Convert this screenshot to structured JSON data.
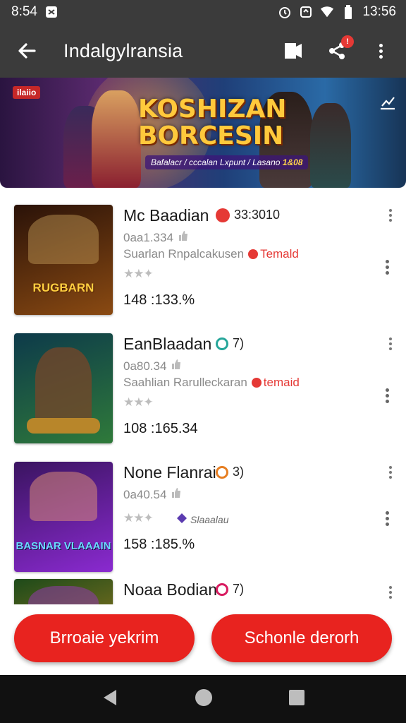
{
  "status_bar": {
    "time": "8:54",
    "clock_right": "13:56"
  },
  "app_bar": {
    "title": "Indalgylransia",
    "notification_count": "!"
  },
  "banner": {
    "tag": "ilaiio",
    "headline_line1": "KOSHIZAN",
    "headline_line2": "BORCESIN",
    "sub_text": "Bafalacr / cccalan Lxpunt / Lasano",
    "sub_highlight": "1&08"
  },
  "items": [
    {
      "name": "Mc Baadian",
      "pill_text": "33:3010",
      "pill_color": "#e53935",
      "meta": "0aa1.334",
      "desc": "Suarlan Rnpalcakusen",
      "desc_tag": "Temald",
      "score": "148 :133.%",
      "thumb_title": "RUGBARN",
      "thumb_colors": [
        "#2a1208",
        "#8a4a12"
      ]
    },
    {
      "name": "EanBlaadan",
      "pill_text": "7)",
      "pill_color": "#26a69a",
      "meta": "0a80.34",
      "desc": "Saahlian Rarulleckaran",
      "desc_tag": "temaid",
      "score": "108 :165.34",
      "thumb_title": "",
      "thumb_colors": [
        "#0d3a4a",
        "#2f7a3a"
      ]
    },
    {
      "name": "None Flanrai",
      "pill_text": "3)",
      "pill_color": "#e67e22",
      "meta": "0a40.54",
      "desc": "",
      "desc_tag": "",
      "badge_label": "Slaaalau",
      "score": "158 :185.%",
      "thumb_title": "BASNAR VLAAAIN",
      "thumb_colors": [
        "#3a1460",
        "#8a2ad0"
      ]
    },
    {
      "name": "Noaa Bodian",
      "pill_text": "7)",
      "pill_color": "#d81b60",
      "meta": "",
      "desc": "",
      "desc_tag": "",
      "score": "",
      "thumb_title": "",
      "thumb_colors": [
        "#1d4a1a",
        "#c08a20"
      ]
    }
  ],
  "buttons": {
    "left": "Brroaie yekrim",
    "right": "Schonle derorh"
  }
}
